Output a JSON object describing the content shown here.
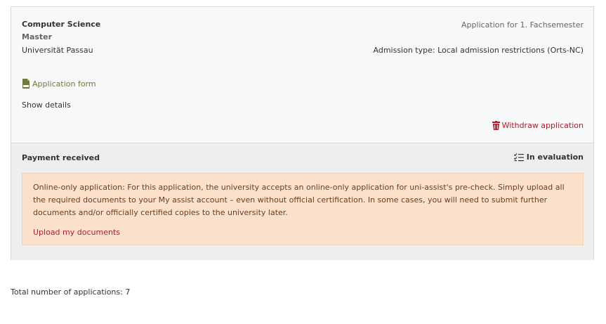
{
  "application": {
    "degree": "Computer Science",
    "level": "Master",
    "university": "Universität Passau",
    "semester": "Application for 1. Fachsemester",
    "admission": "Admission type: Local admission restrictions (Orts-NC)",
    "form_link_label": "Application form",
    "form_icon": "pdf-file-icon",
    "show_details_label": "Show details",
    "withdraw_label": "Withdraw application",
    "withdraw_icon": "trash-icon"
  },
  "payment": {
    "status_label": "Payment received",
    "evaluation_label": "In evaluation",
    "evaluation_icon": "checklist-icon"
  },
  "notice": {
    "text": "Online-only application: For this application, the university accepts an online-only application for uni-assist's pre-check. Simply upload all the required documents to your My assist account – even without official certification. In some cases, you will need to submit further documents and/or officially certified copies to the university later.",
    "upload_label": "Upload my documents"
  },
  "footer": {
    "total_label": "Total number of applications: 7"
  },
  "colors": {
    "link_olive": "#6f7b3b",
    "danger_red": "#b01d2e",
    "notice_bg": "#fbe1cc"
  }
}
